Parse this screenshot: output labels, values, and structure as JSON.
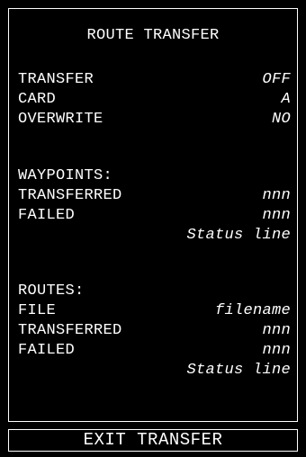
{
  "colors": {
    "background": "#000000",
    "foreground": "#ffffff"
  },
  "page_title": "ROUTE TRANSFER",
  "settings": {
    "transfer": {
      "label": "TRANSFER",
      "value": "OFF"
    },
    "card": {
      "label": "CARD",
      "value": "A"
    },
    "overwrite": {
      "label": "OVERWRITE",
      "value": "NO"
    }
  },
  "waypoints": {
    "heading": "WAYPOINTS:",
    "transferred": {
      "label": "TRANSFERRED",
      "value": "nnn"
    },
    "failed": {
      "label": "FAILED",
      "value": "nnn"
    },
    "status": "Status line"
  },
  "routes": {
    "heading": "ROUTES:",
    "file": {
      "label": "FILE",
      "value": "filename"
    },
    "transferred": {
      "label": "TRANSFERRED",
      "value": "nnn"
    },
    "failed": {
      "label": "FAILED",
      "value": "nnn"
    },
    "status": "Status line"
  },
  "exit_label": "EXIT TRANSFER"
}
